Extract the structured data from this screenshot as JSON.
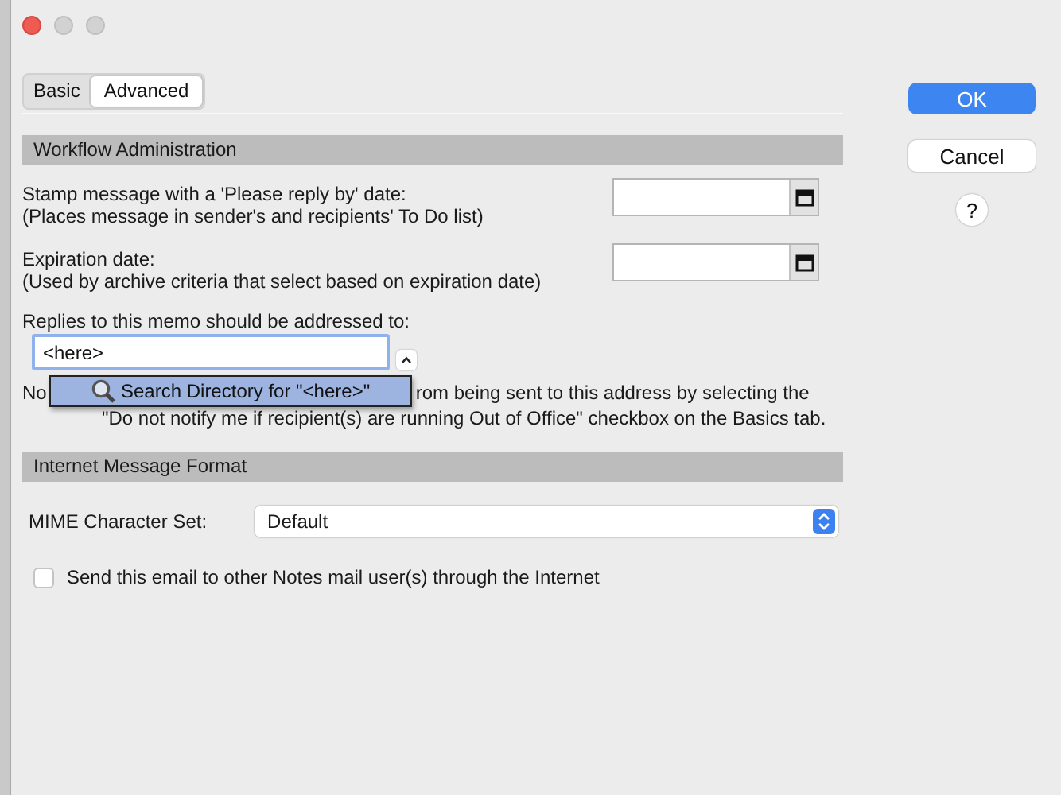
{
  "tabs": [
    {
      "label": "Basic",
      "selected": false
    },
    {
      "label": "Advanced",
      "selected": true
    }
  ],
  "buttons": {
    "ok": "OK",
    "cancel": "Cancel",
    "help": "?"
  },
  "workflow": {
    "title": "Workflow Administration",
    "stamp": {
      "label": "Stamp message with a 'Please reply by' date:",
      "hint": "(Places message in sender's and recipients' To Do list)"
    },
    "expiration": {
      "label": "Expiration date:",
      "hint": "(Used by archive criteria that select based on expiration date)"
    },
    "replies": {
      "label": "Replies to this memo should be addressed to:",
      "value": "<here>"
    },
    "suggestion": "Search Directory for \"<here>\"",
    "note_start": "No",
    "note_rest": "rom being sent to this address by selecting the",
    "note_line2": "\"Do not notify me if recipient(s) are running Out of Office\" checkbox on the Basics tab."
  },
  "internet": {
    "title": "Internet Message Format",
    "mime_label": "MIME Character Set:",
    "mime_value": "Default",
    "send_label": "Send this email to other Notes mail user(s) through the Internet",
    "send_checked": false
  }
}
